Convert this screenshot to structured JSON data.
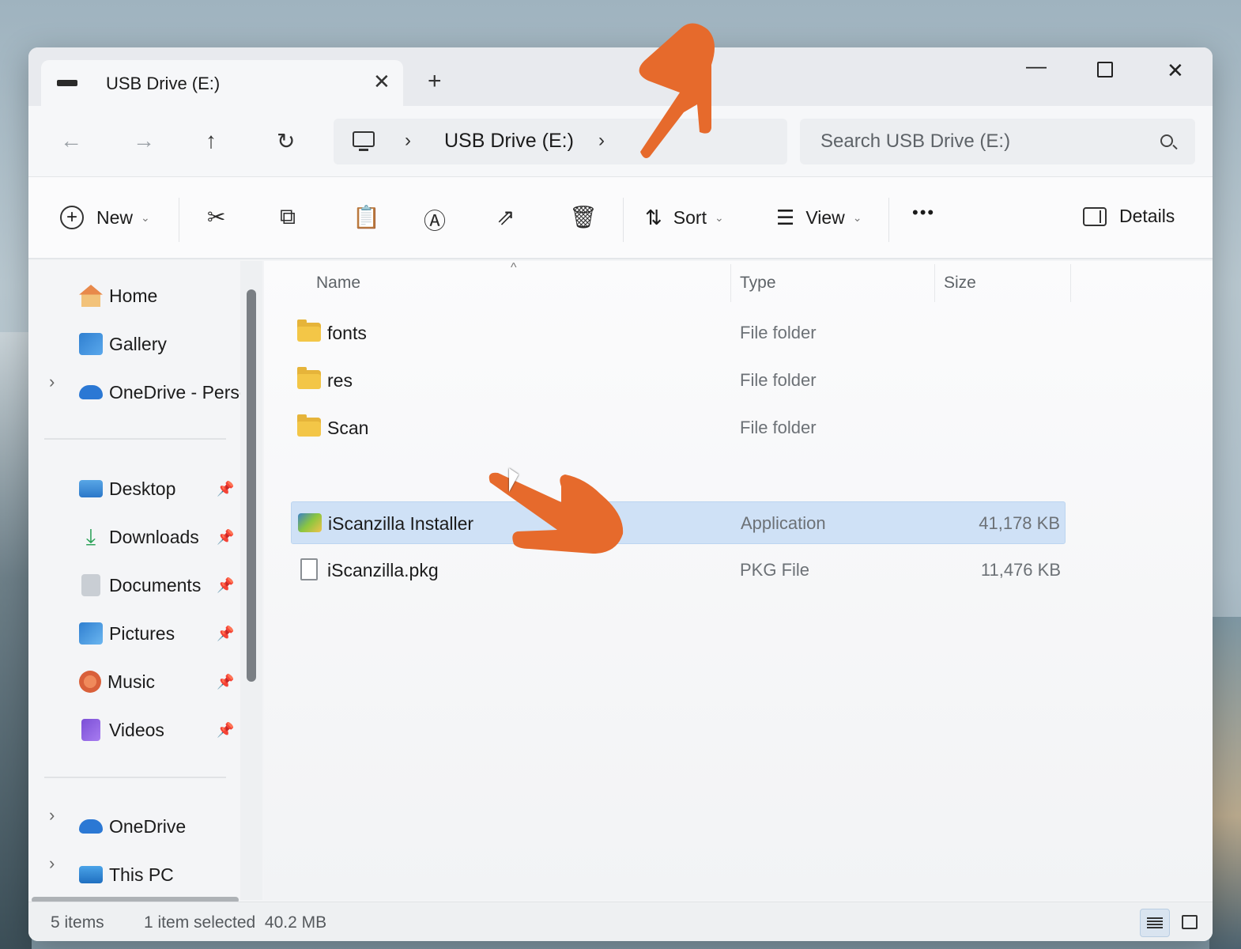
{
  "window": {
    "tab_title": "USB Drive (E:)",
    "tab_close": "✕",
    "new_tab": "+",
    "controls": {
      "minimize": "—",
      "close": "✕"
    }
  },
  "nav": {
    "back": "←",
    "forward": "→",
    "up": "↑",
    "refresh": "↻",
    "breadcrumb_sep": "›",
    "breadcrumb": "USB Drive (E:)",
    "search_placeholder": "Search USB Drive (E:)"
  },
  "toolbar": {
    "new_label": "New",
    "sort_label": "Sort",
    "view_label": "View",
    "more_label": "•••",
    "details_label": "Details",
    "chevron": "⌄",
    "icons": [
      "cut-icon",
      "copy-icon",
      "paste-icon",
      "rename-icon",
      "share-icon",
      "delete-icon"
    ]
  },
  "sidebar": {
    "top_items": [
      {
        "label": "Home",
        "icon": "home-icon"
      },
      {
        "label": "Gallery",
        "icon": "gallery-icon"
      },
      {
        "label": "OneDrive - Perso",
        "icon": "onedrive-icon"
      }
    ],
    "pinned": [
      {
        "label": "Desktop",
        "icon": "desktop-icon"
      },
      {
        "label": "Downloads",
        "icon": "downloads-icon"
      },
      {
        "label": "Documents",
        "icon": "documents-icon"
      },
      {
        "label": "Pictures",
        "icon": "pictures-icon"
      },
      {
        "label": "Music",
        "icon": "music-icon"
      },
      {
        "label": "Videos",
        "icon": "videos-icon"
      }
    ],
    "bottom_items": [
      {
        "label": "OneDrive",
        "icon": "onedrive-icon"
      },
      {
        "label": "This PC",
        "icon": "this-pc-icon"
      }
    ],
    "expander": "›",
    "pin_glyph": "📌"
  },
  "list": {
    "columns": {
      "name": "Name",
      "type": "Type",
      "size": "Size"
    },
    "sort_caret": "^",
    "rows": [
      {
        "name": "fonts",
        "type": "File folder",
        "size": "",
        "icon": "folder-icon"
      },
      {
        "name": "res",
        "type": "File folder",
        "size": "",
        "icon": "folder-icon"
      },
      {
        "name": "Scan",
        "type": "File folder",
        "size": "",
        "icon": "folder-icon"
      },
      {
        "name": "iScanzilla Installer",
        "type": "Application",
        "size": "41,178 KB",
        "icon": "application-icon",
        "selected": true
      },
      {
        "name": "iScanzilla.pkg",
        "type": "PKG File",
        "size": "11,476 KB",
        "icon": "file-icon"
      }
    ]
  },
  "status": {
    "items": "5 items",
    "selection": "1 item selected  40.2 MB"
  },
  "colors": {
    "accent_pointer": "#e66a2c",
    "selection": "#cfe1f6"
  }
}
